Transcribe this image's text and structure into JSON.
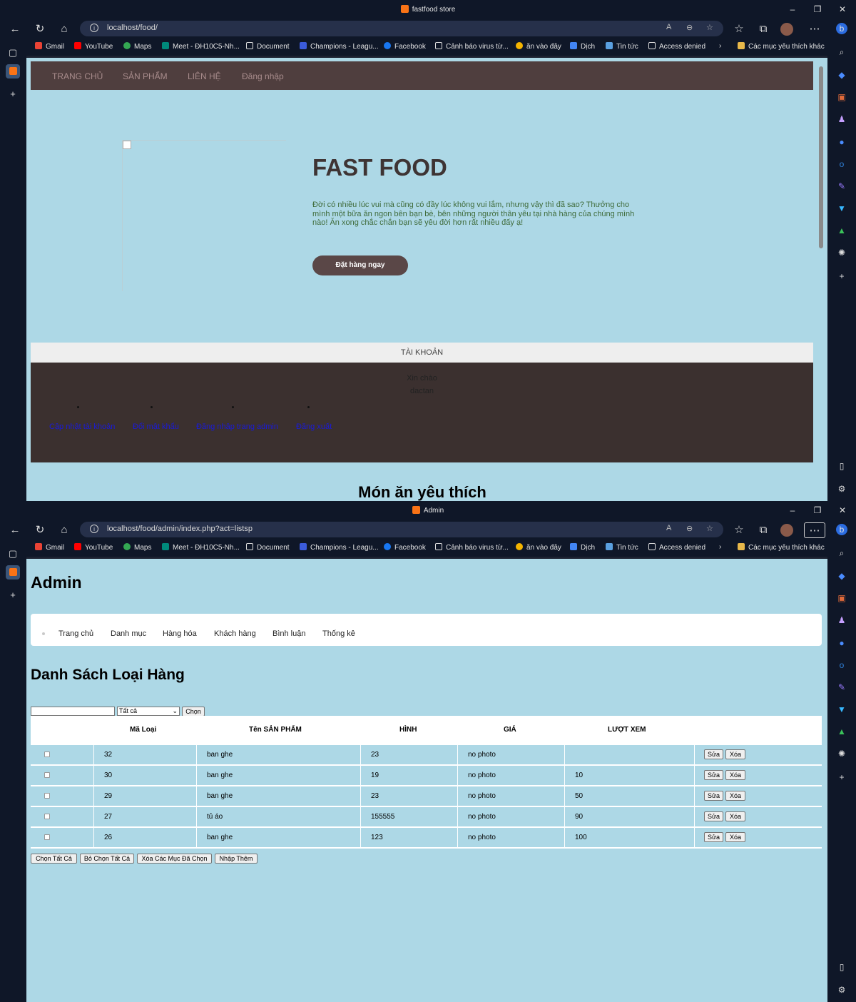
{
  "window1": {
    "tab_title": "fastfood store",
    "url": "localhost/food/",
    "nav": [
      "TRANG CHỦ",
      "SẢN PHẨM",
      "LIÊN HỆ",
      "Đăng nhập"
    ],
    "hero_title": "FAST FOOD",
    "hero_text": "Đời có nhiều lúc vui mà cũng có đầy lúc không vui lắm, nhưng vậy thì đã sao? Thưởng cho mình một bữa ăn ngon bên bạn bè, bên những người thân yêu tại nhà hàng của chúng mình nào! Ăn xong chắc chắn bạn sẽ yêu đời hơn rất nhiều đấy ạ!",
    "order_button": "Đặt hàng ngay",
    "account_title": "TÀI KHOẢN",
    "greeting": "Xin chào",
    "username": "dactan",
    "account_links": [
      "Cập nhật tài khoản",
      "Đổi mật khẩu",
      "Đăng nhập trang admin",
      "Đăng xuất"
    ],
    "favorites_title": "Món ăn yêu thích"
  },
  "window2": {
    "tab_title": "Admin",
    "url": "localhost/food/admin/index.php?act=listsp",
    "heading": "Admin",
    "menu": [
      "Trang chủ",
      "Danh mục",
      "Hàng hóa",
      "Khách hàng",
      "Bình luận",
      "Thống kê"
    ],
    "list_title": "Danh Sách Loại Hàng",
    "filter_select": "Tất cả",
    "filter_button": "Chọn",
    "columns": [
      "Mã Loại",
      "Tên SẢN PHẨM",
      "HÌNH",
      "GIÁ",
      "LƯỢT XEM"
    ],
    "rows": [
      {
        "id": "32",
        "name": "ban ghe",
        "c3": "23",
        "c4": "no photo",
        "views": ""
      },
      {
        "id": "30",
        "name": "ban ghe",
        "c3": "19",
        "c4": "no photo",
        "views": "10"
      },
      {
        "id": "29",
        "name": "ban ghe",
        "c3": "23",
        "c4": "no photo",
        "views": "50"
      },
      {
        "id": "27",
        "name": "tủ áo",
        "c3": "155555",
        "c4": "no photo",
        "views": "90"
      },
      {
        "id": "26",
        "name": "ban ghe",
        "c3": "123",
        "c4": "no photo",
        "views": "100"
      }
    ],
    "edit_label": "Sửa",
    "delete_label": "Xóa",
    "bottom_buttons": [
      "Chọn Tất Cả",
      "Bỏ Chọn Tất Cả",
      "Xóa Các Mục Đã Chọn",
      "Nhập Thêm"
    ]
  },
  "browser": {
    "bookmarks": [
      "Gmail",
      "YouTube",
      "Maps",
      "Meet - ĐH10C5-Nh...",
      "Document",
      "Champions - Leagu...",
      "Facebook",
      "Cảnh báo virus từ...",
      "ăn vào đây",
      "Dịch",
      "Tin tức",
      "Access denied"
    ],
    "other_bookmarks": "Các mục yêu thích khác"
  },
  "colors": {
    "page_bg": "#add8e6",
    "nav_bg": "#4f3e3e",
    "account_bg": "#3b302f",
    "link": "#1a1ad8"
  }
}
